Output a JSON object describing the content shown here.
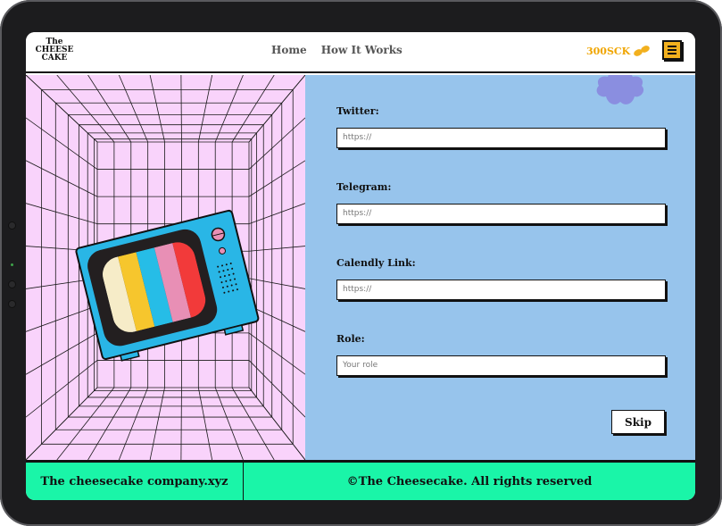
{
  "brand": {
    "logo_lines": [
      "The",
      "CHEESE",
      "CAKE"
    ]
  },
  "nav": {
    "items": [
      {
        "label": "Home"
      },
      {
        "label": "How It Works"
      }
    ]
  },
  "header": {
    "balance": "300SCK"
  },
  "form": {
    "fields": [
      {
        "label": "Twitter:",
        "placeholder": "https://"
      },
      {
        "label": "Telegram:",
        "placeholder": "https://"
      },
      {
        "label": "Calendly Link:",
        "placeholder": "https://"
      },
      {
        "label": "Role:",
        "placeholder": "Your role"
      }
    ],
    "skip_label": "Skip"
  },
  "footer": {
    "site": "The cheesecake company.xyz",
    "copyright": "©The Cheesecake. All rights reserved"
  },
  "colors": {
    "accent_yellow": "#f2b01e",
    "balance_text": "#f0a500",
    "grid_bg": "#f9d3fb",
    "form_bg": "#97c4ec",
    "footer_bg": "#1af5a8",
    "blob": "#8a8ee0",
    "tv_body": "#29b6e6",
    "tv_stripes": [
      "#f6ecc8",
      "#f6c62d",
      "#26bde7",
      "#e88fb5",
      "#f23a3a"
    ]
  },
  "icons": {
    "menu": "menu-icon",
    "coins": "coins-icon"
  }
}
